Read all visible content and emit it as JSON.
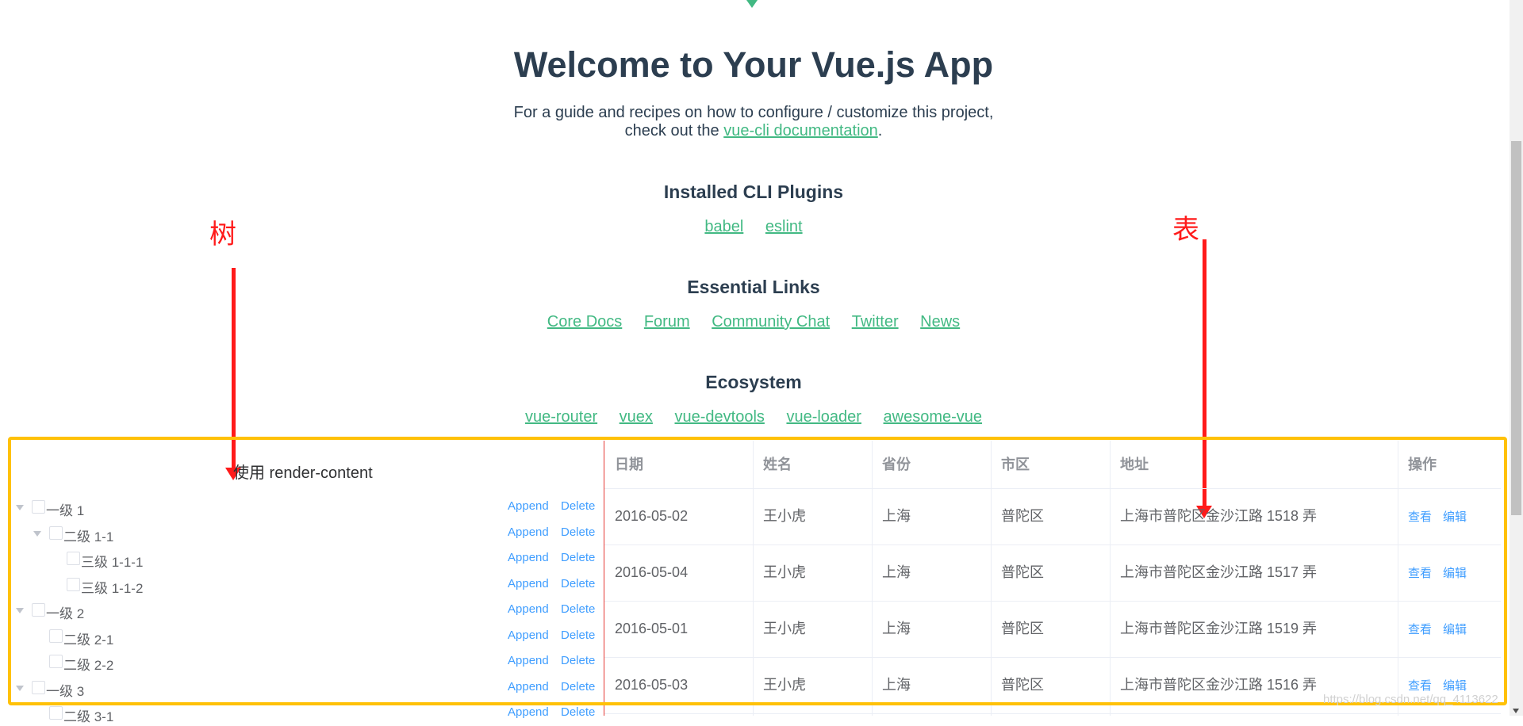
{
  "header": {
    "title": "Welcome to Your Vue.js App",
    "subtitle_line1": "For a guide and recipes on how to configure / customize this project,",
    "subtitle_prefix": "check out the",
    "subtitle_link": "vue-cli documentation",
    "subtitle_suffix": "."
  },
  "sections": {
    "plugins": {
      "title": "Installed CLI Plugins",
      "links": [
        "babel",
        "eslint"
      ]
    },
    "essential": {
      "title": "Essential Links",
      "links": [
        "Core Docs",
        "Forum",
        "Community Chat",
        "Twitter",
        "News"
      ]
    },
    "ecosystem": {
      "title": "Ecosystem",
      "links": [
        "vue-router",
        "vuex",
        "vue-devtools",
        "vue-loader",
        "awesome-vue"
      ]
    }
  },
  "annotations": {
    "tree_note": "树",
    "table_note": "表",
    "accent": "#ff1a1a",
    "frame_color": "#ffc107"
  },
  "tree": {
    "title": "使用 render-content",
    "append_label": "Append",
    "delete_label": "Delete",
    "nodes": [
      {
        "label": "一级 1",
        "expanded": true
      },
      {
        "label": "二级 1-1",
        "expanded": true
      },
      {
        "label": "三级 1-1-1"
      },
      {
        "label": "三级 1-1-2"
      },
      {
        "label": "一级 2",
        "expanded": true
      },
      {
        "label": "二级 2-1"
      },
      {
        "label": "二级 2-2"
      },
      {
        "label": "一级 3",
        "expanded": true
      },
      {
        "label": "二级 3-1"
      }
    ]
  },
  "table": {
    "headers": [
      "日期",
      "姓名",
      "省份",
      "市区",
      "地址",
      "操作"
    ],
    "view_label": "查看",
    "edit_label": "编辑",
    "rows": [
      [
        "2016-05-02",
        "王小虎",
        "上海",
        "普陀区",
        "上海市普陀区金沙江路 1518 弄"
      ],
      [
        "2016-05-04",
        "王小虎",
        "上海",
        "普陀区",
        "上海市普陀区金沙江路 1517 弄"
      ],
      [
        "2016-05-01",
        "王小虎",
        "上海",
        "普陀区",
        "上海市普陀区金沙江路 1519 弄"
      ],
      [
        "2016-05-03",
        "王小虎",
        "上海",
        "普陀区",
        "上海市普陀区金沙江路 1516 弄"
      ]
    ]
  },
  "watermark": "https://blog.csdn.net/qq_4113622"
}
